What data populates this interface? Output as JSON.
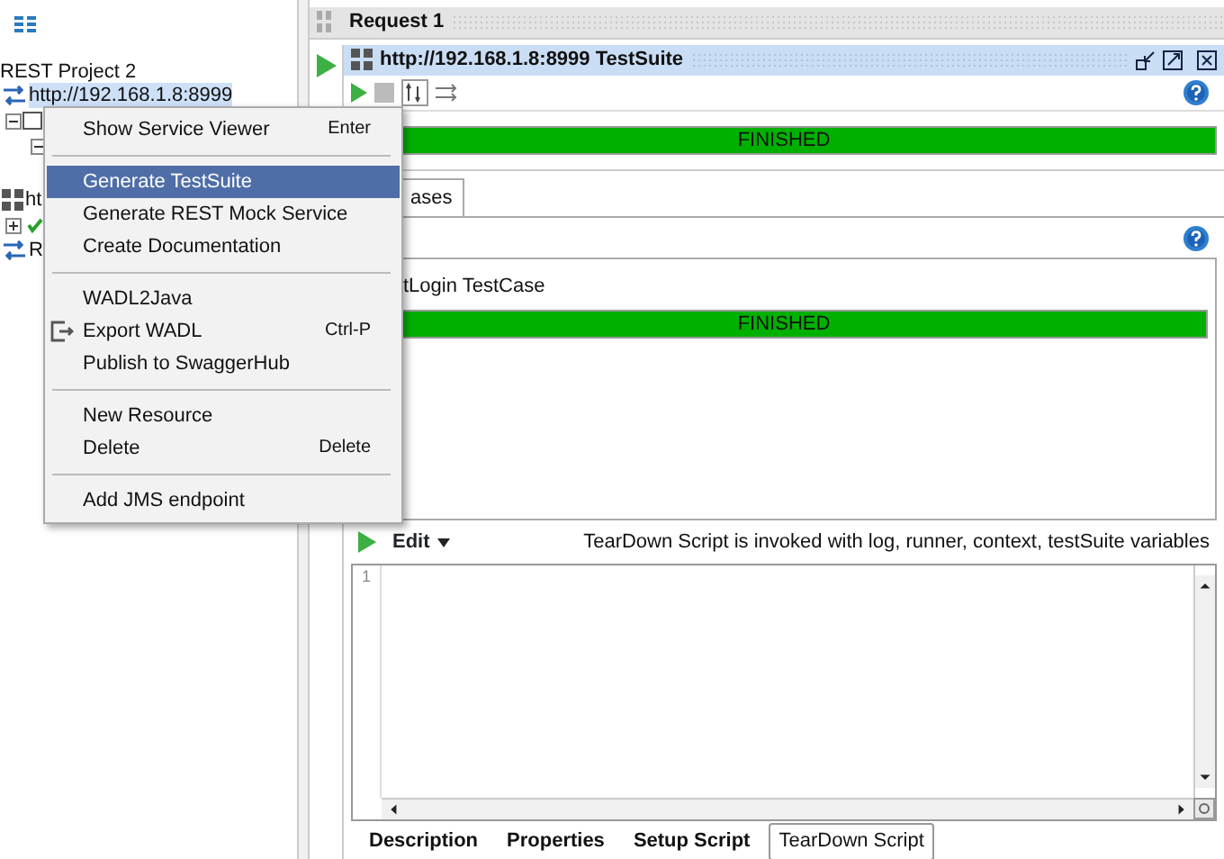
{
  "sidebar": {
    "items": [
      {
        "kind": "project",
        "label": "REST Project 2",
        "selected": false
      },
      {
        "kind": "service",
        "label": "http://192.168.1.8:8999",
        "selected": true
      },
      {
        "kind": "node",
        "selected": false
      },
      {
        "kind": "subnode",
        "selected": false
      },
      {
        "kind": "suite",
        "label": "ht",
        "selected": false
      },
      {
        "kind": "check",
        "selected": false
      },
      {
        "kind": "service",
        "label": "R",
        "selected": false
      }
    ]
  },
  "editor_tab": {
    "title": "Request 1"
  },
  "suite_window": {
    "title": "http://192.168.1.8:8999 TestSuite",
    "status": "FINISHED",
    "level": 1,
    "tabs": [
      {
        "label": "ases",
        "selected": true
      }
    ],
    "testcases": [
      {
        "name": "tLogin TestCase",
        "status": "FINISHED",
        "level": 1
      }
    ],
    "script": {
      "edit_label": "Edit",
      "hint": "TearDown Script is invoked with log, runner, context, testSuite variables",
      "line_numbers": [
        "1"
      ]
    },
    "bottom_tabs": [
      {
        "label": "Description",
        "selected": false
      },
      {
        "label": "Properties",
        "selected": false
      },
      {
        "label": "Setup Script",
        "selected": false
      },
      {
        "label": "TearDown Script",
        "selected": true
      }
    ]
  },
  "context_menu": {
    "items": [
      {
        "kind": "item",
        "label": "Show Service Viewer",
        "shortcut": "Enter",
        "selected": false
      },
      {
        "kind": "separator"
      },
      {
        "kind": "item",
        "label": "Generate TestSuite",
        "selected": true
      },
      {
        "kind": "item",
        "label": "Generate REST Mock Service",
        "selected": false
      },
      {
        "kind": "item",
        "label": "Create Documentation",
        "selected": false
      },
      {
        "kind": "separator"
      },
      {
        "kind": "item",
        "label": "WADL2Java",
        "selected": false
      },
      {
        "kind": "icon_item",
        "label": "Export WADL",
        "shortcut": "Ctrl-P",
        "selected": false
      },
      {
        "kind": "item",
        "label": "Publish to SwaggerHub",
        "selected": false
      },
      {
        "kind": "separator"
      },
      {
        "kind": "item",
        "label": "New Resource",
        "selected": false
      },
      {
        "kind": "item",
        "label": "Delete",
        "shortcut": "Delete",
        "selected": false
      },
      {
        "kind": "separator"
      },
      {
        "kind": "item",
        "label": "Add JMS endpoint",
        "selected": false
      }
    ]
  }
}
